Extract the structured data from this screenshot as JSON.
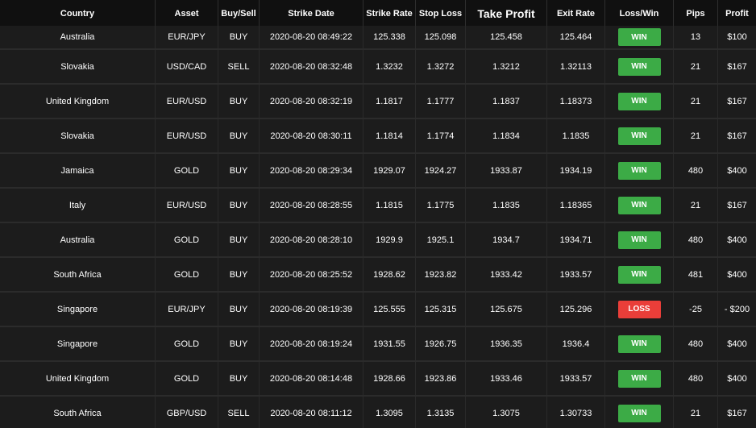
{
  "columns": [
    "Country",
    "Asset",
    "Buy/Sell",
    "Strike Date",
    "Strike Rate",
    "Stop Loss",
    "Take Profit",
    "Exit Rate",
    "Loss/Win",
    "Pips",
    "Profit"
  ],
  "colors": {
    "win": "#3cab46",
    "loss": "#ea3e39",
    "background": "#1c1c1c",
    "header": "#101010"
  },
  "rows": [
    {
      "country": "Australia",
      "asset": "EUR/JPY",
      "side": "BUY",
      "date": "2020-08-20 08:49:22",
      "strike": "125.338",
      "stop": "125.098",
      "take": "125.458",
      "exit": "125.464",
      "result": "WIN",
      "pips": "13",
      "profit": "$100"
    },
    {
      "country": "Slovakia",
      "asset": "USD/CAD",
      "side": "SELL",
      "date": "2020-08-20 08:32:48",
      "strike": "1.3232",
      "stop": "1.3272",
      "take": "1.3212",
      "exit": "1.32113",
      "result": "WIN",
      "pips": "21",
      "profit": "$167"
    },
    {
      "country": "United Kingdom",
      "asset": "EUR/USD",
      "side": "BUY",
      "date": "2020-08-20 08:32:19",
      "strike": "1.1817",
      "stop": "1.1777",
      "take": "1.1837",
      "exit": "1.18373",
      "result": "WIN",
      "pips": "21",
      "profit": "$167"
    },
    {
      "country": "Slovakia",
      "asset": "EUR/USD",
      "side": "BUY",
      "date": "2020-08-20 08:30:11",
      "strike": "1.1814",
      "stop": "1.1774",
      "take": "1.1834",
      "exit": "1.1835",
      "result": "WIN",
      "pips": "21",
      "profit": "$167"
    },
    {
      "country": "Jamaica",
      "asset": "GOLD",
      "side": "BUY",
      "date": "2020-08-20 08:29:34",
      "strike": "1929.07",
      "stop": "1924.27",
      "take": "1933.87",
      "exit": "1934.19",
      "result": "WIN",
      "pips": "480",
      "profit": "$400"
    },
    {
      "country": "Italy",
      "asset": "EUR/USD",
      "side": "BUY",
      "date": "2020-08-20 08:28:55",
      "strike": "1.1815",
      "stop": "1.1775",
      "take": "1.1835",
      "exit": "1.18365",
      "result": "WIN",
      "pips": "21",
      "profit": "$167"
    },
    {
      "country": "Australia",
      "asset": "GOLD",
      "side": "BUY",
      "date": "2020-08-20 08:28:10",
      "strike": "1929.9",
      "stop": "1925.1",
      "take": "1934.7",
      "exit": "1934.71",
      "result": "WIN",
      "pips": "480",
      "profit": "$400"
    },
    {
      "country": "South Africa",
      "asset": "GOLD",
      "side": "BUY",
      "date": "2020-08-20 08:25:52",
      "strike": "1928.62",
      "stop": "1923.82",
      "take": "1933.42",
      "exit": "1933.57",
      "result": "WIN",
      "pips": "481",
      "profit": "$400"
    },
    {
      "country": "Singapore",
      "asset": "EUR/JPY",
      "side": "BUY",
      "date": "2020-08-20 08:19:39",
      "strike": "125.555",
      "stop": "125.315",
      "take": "125.675",
      "exit": "125.296",
      "result": "LOSS",
      "pips": "-25",
      "profit": "- $200"
    },
    {
      "country": "Singapore",
      "asset": "GOLD",
      "side": "BUY",
      "date": "2020-08-20 08:19:24",
      "strike": "1931.55",
      "stop": "1926.75",
      "take": "1936.35",
      "exit": "1936.4",
      "result": "WIN",
      "pips": "480",
      "profit": "$400"
    },
    {
      "country": "United Kingdom",
      "asset": "GOLD",
      "side": "BUY",
      "date": "2020-08-20 08:14:48",
      "strike": "1928.66",
      "stop": "1923.86",
      "take": "1933.46",
      "exit": "1933.57",
      "result": "WIN",
      "pips": "480",
      "profit": "$400"
    },
    {
      "country": "South Africa",
      "asset": "GBP/USD",
      "side": "SELL",
      "date": "2020-08-20 08:11:12",
      "strike": "1.3095",
      "stop": "1.3135",
      "take": "1.3075",
      "exit": "1.30733",
      "result": "WIN",
      "pips": "21",
      "profit": "$167"
    }
  ]
}
